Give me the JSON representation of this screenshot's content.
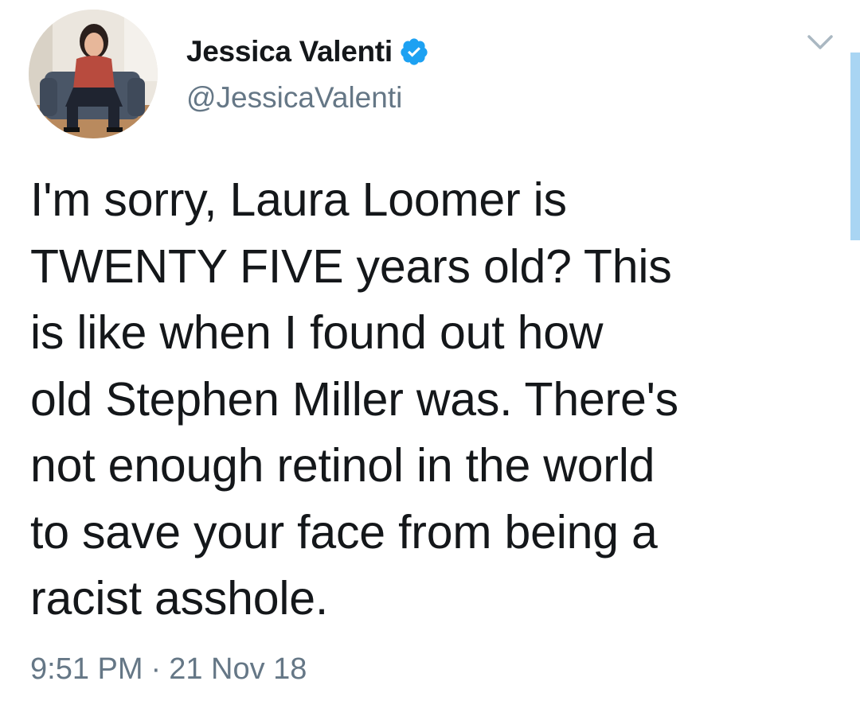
{
  "author": {
    "display_name": "Jessica Valenti",
    "handle": "@JessicaValenti",
    "verified_icon": "verified-badge-icon",
    "avatar": "profile-photo"
  },
  "tweet": {
    "lines": [
      "I'm sorry, Laura Loomer is",
      "TWENTY FIVE years old? This",
      "is like when I found out how",
      "old Stephen Miller was. There's",
      "not enough retinol in the world",
      "to save your face from being a",
      "racist asshole."
    ]
  },
  "meta": {
    "time": "9:51 PM",
    "separator": "·",
    "date": "21 Nov 18"
  },
  "colors": {
    "text": "#14171a",
    "secondary": "#657786",
    "verified": "#1da1f2",
    "scrollbar": "#a9d5f3"
  },
  "icons": {
    "menu": "chevron-down-icon"
  }
}
